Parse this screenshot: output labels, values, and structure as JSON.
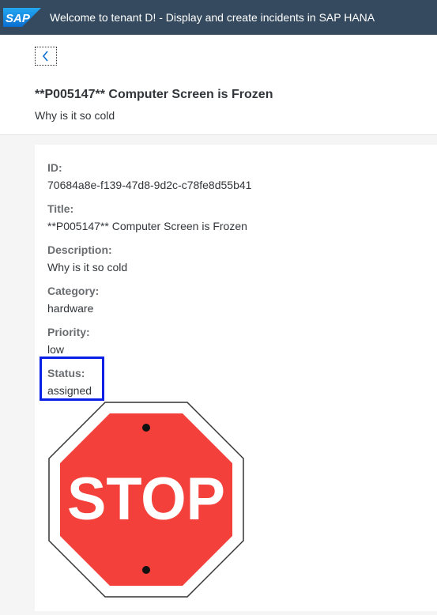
{
  "shell": {
    "logo_text": "SAP",
    "title": "Welcome to tenant D! - Display and create incidents in SAP HANA"
  },
  "header": {
    "title": "**P005147** Computer Screen is Frozen",
    "subtitle": "Why is it so cold"
  },
  "fields": [
    {
      "label": "ID:",
      "value": "70684a8e-f139-47d8-9d2c-c78fe8d55b41"
    },
    {
      "label": "Title:",
      "value": "**P005147** Computer Screen is Frozen"
    },
    {
      "label": "Description:",
      "value": "Why is it so cold"
    },
    {
      "label": "Category:",
      "value": "hardware"
    },
    {
      "label": "Priority:",
      "value": "low"
    },
    {
      "label": "Status:",
      "value": "assigned"
    }
  ],
  "image": {
    "text": "STOP",
    "icon": "stop-sign",
    "colors": {
      "fill": "#f4403a",
      "border": "#ffffff",
      "outline": "#333333"
    }
  },
  "colors": {
    "shellbar": "#354a5f",
    "sap_blue": "#1b6fc7",
    "highlight": "#0a1fe6"
  }
}
